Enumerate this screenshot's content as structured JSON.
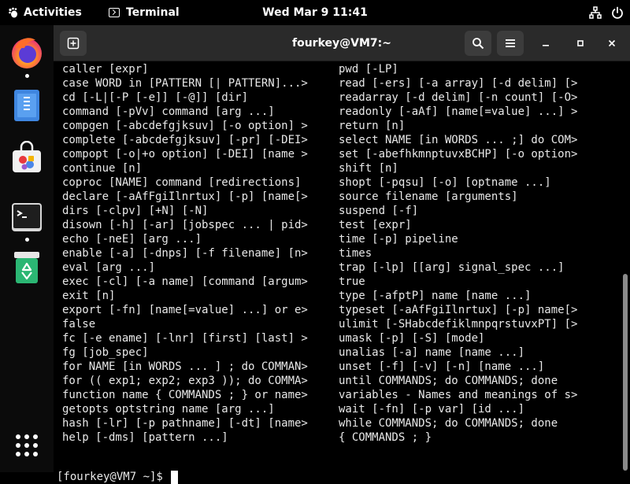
{
  "topbar": {
    "activities_label": "Activities",
    "app_label": "Terminal",
    "clock": "Wed Mar 9  11:41",
    "icons": [
      "gnome-foot-icon",
      "terminal-app-icon",
      "network-icon",
      "power-icon"
    ]
  },
  "dock": {
    "items": [
      {
        "name": "firefox",
        "icon": "firefox-icon",
        "running": true
      },
      {
        "name": "text-editor",
        "icon": "text-editor-icon",
        "running": false
      },
      {
        "name": "software",
        "icon": "software-center-icon",
        "running": false
      },
      {
        "name": "terminal",
        "icon": "terminal-icon",
        "running": true
      },
      {
        "name": "trash",
        "icon": "trash-icon",
        "running": false
      },
      {
        "name": "app-grid",
        "icon": "app-grid-icon",
        "running": false
      }
    ]
  },
  "window": {
    "title": "fourkey@VM7:~",
    "buttons": [
      "new-tab-icon",
      "search-icon",
      "hamburger-menu-icon",
      "minimize-icon",
      "maximize-icon",
      "close-icon"
    ]
  },
  "terminal": {
    "left_lines": [
      "caller [expr]",
      "case WORD in [PATTERN [| PATTERN]...>",
      "cd [-L|[-P [-e]] [-@]] [dir]",
      "command [-pVv] command [arg ...]",
      "compgen [-abcdefgjksuv] [-o option] >",
      "complete [-abcdefgjksuv] [-pr] [-DEI>",
      "compopt [-o|+o option] [-DEI] [name >",
      "continue [n]",
      "coproc [NAME] command [redirections]",
      "declare [-aAfFgiIlnrtux] [-p] [name[>",
      "dirs [-clpv] [+N] [-N]",
      "disown [-h] [-ar] [jobspec ... | pid>",
      "echo [-neE] [arg ...]",
      "enable [-a] [-dnps] [-f filename] [n>",
      "eval [arg ...]",
      "exec [-cl] [-a name] [command [argum>",
      "exit [n]",
      "export [-fn] [name[=value] ...] or e>",
      "false",
      "fc [-e ename] [-lnr] [first] [last] >",
      "fg [job_spec]",
      "for NAME [in WORDS ... ] ; do COMMAN>",
      "for (( exp1; exp2; exp3 )); do COMMA>",
      "function name { COMMANDS ; } or name>",
      "getopts optstring name [arg ...]",
      "hash [-lr] [-p pathname] [-dt] [name>",
      "help [-dms] [pattern ...]"
    ],
    "right_lines": [
      "pwd [-LP]",
      "read [-ers] [-a array] [-d delim] [>",
      "readarray [-d delim] [-n count] [-O>",
      "readonly [-aAf] [name[=value] ...] >",
      "return [n]",
      "select NAME [in WORDS ... ;] do COM>",
      "set [-abefhkmnptuvxBCHP] [-o option>",
      "shift [n]",
      "shopt [-pqsu] [-o] [optname ...]",
      "source filename [arguments]",
      "suspend [-f]",
      "test [expr]",
      "time [-p] pipeline",
      "times",
      "trap [-lp] [[arg] signal_spec ...]",
      "true",
      "type [-afptP] name [name ...]",
      "typeset [-aAfFgiIlnrtux] [-p] name[>",
      "ulimit [-SHabcdefiklmnpqrstuvxPT] [>",
      "umask [-p] [-S] [mode]",
      "unalias [-a] name [name ...]",
      "unset [-f] [-v] [-n] [name ...]",
      "until COMMANDS; do COMMANDS; done",
      "variables - Names and meanings of s>",
      "wait [-fn] [-p var] [id ...]",
      "while COMMANDS; do COMMANDS; done",
      "{ COMMANDS ; }"
    ],
    "prompt": "[fourkey@VM7 ~]$ "
  },
  "colors": {
    "background": "#000000",
    "headerbar": "#2a2a2a",
    "button": "#3c3c3c",
    "text": "#e8e8e8"
  }
}
